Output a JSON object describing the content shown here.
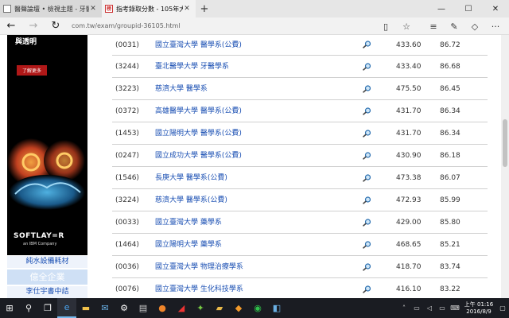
{
  "browser": {
    "tabs": [
      {
        "title": "醫聲論壇 • 檢視主題 - 牙醫全",
        "active": false
      },
      {
        "title": "指考錄取分數 - 105年大",
        "active": true
      }
    ],
    "new_tab_label": "+",
    "url": "com.tw/exam/groupid-36105.html"
  },
  "ad": {
    "headline": "與透明",
    "more_label": "了解更多",
    "logo": "SOFTLAY=R",
    "logo_sub": "an IBM Company",
    "links": [
      "純水設備耗材",
      "億全企業",
      "李仕宇書中詰"
    ]
  },
  "table": {
    "rows": [
      {
        "code": "(0031)",
        "name": "國立臺灣大學 醫學系(公費)",
        "avg": "433.60",
        "score": "86.72"
      },
      {
        "code": "(3244)",
        "name": "臺北醫學大學 牙醫學系",
        "avg": "433.40",
        "score": "86.68"
      },
      {
        "code": "(3223)",
        "name": "慈濟大學 醫學系",
        "avg": "475.50",
        "score": "86.45"
      },
      {
        "code": "(0372)",
        "name": "高雄醫學大學 醫學系(公費)",
        "avg": "431.70",
        "score": "86.34"
      },
      {
        "code": "(1453)",
        "name": "國立陽明大學 醫學系(公費)",
        "avg": "431.70",
        "score": "86.34"
      },
      {
        "code": "(0247)",
        "name": "國立成功大學 醫學系(公費)",
        "avg": "430.90",
        "score": "86.18"
      },
      {
        "code": "(1546)",
        "name": "長庚大學 醫學系(公費)",
        "avg": "473.38",
        "score": "86.07"
      },
      {
        "code": "(3224)",
        "name": "慈濟大學 醫學系(公費)",
        "avg": "472.93",
        "score": "85.99"
      },
      {
        "code": "(0033)",
        "name": "國立臺灣大學 藥學系",
        "avg": "429.00",
        "score": "85.80"
      },
      {
        "code": "(1464)",
        "name": "國立陽明大學 藥學系",
        "avg": "468.65",
        "score": "85.21"
      },
      {
        "code": "(0036)",
        "name": "國立臺灣大學 物理治療學系",
        "avg": "418.70",
        "score": "83.74"
      },
      {
        "code": "(0076)",
        "name": "國立臺灣大學 生化科技學系",
        "avg": "416.10",
        "score": "83.22"
      }
    ]
  },
  "taskbar": {
    "time": "上午 01:16",
    "date": "2016/8/9"
  }
}
